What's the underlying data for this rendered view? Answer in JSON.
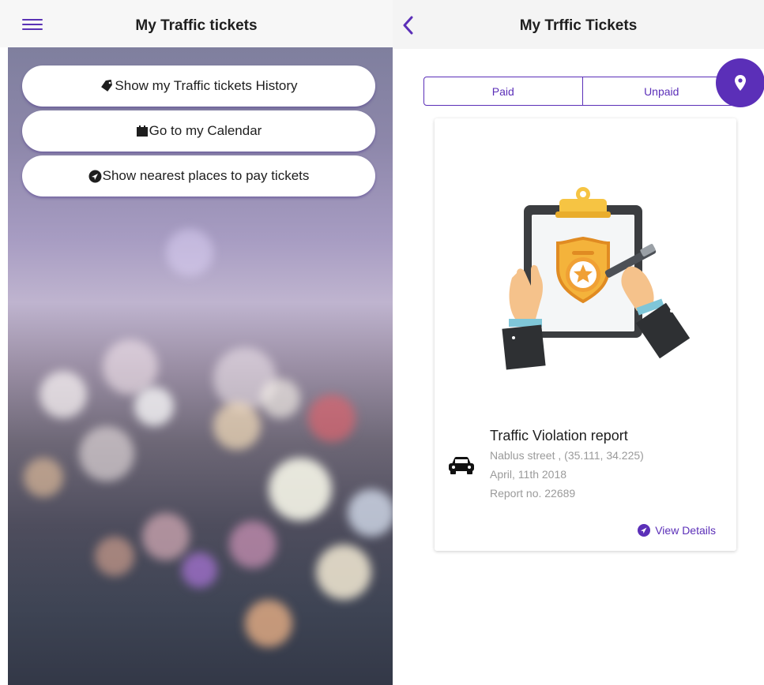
{
  "left": {
    "header": {
      "title": "My Traffic tickets",
      "menu_icon": "hamburger-menu-icon"
    },
    "buttons": [
      {
        "label": "Show my Traffic tickets History",
        "icon": "tag-icon"
      },
      {
        "label": "Go to my Calendar",
        "icon": "calendar-icon"
      },
      {
        "label": "Show nearest places to pay tickets",
        "icon": "navigation-icon"
      }
    ]
  },
  "right": {
    "header": {
      "title": "My Trffic Tickets",
      "back_icon": "chevron-left-icon"
    },
    "tabs": [
      {
        "label": "Paid"
      },
      {
        "label": "Unpaid"
      }
    ],
    "fab_icon": "map-pin-icon",
    "card": {
      "title": "Traffic Violation report",
      "location": "Nablus street , (35.111, 34.225)",
      "date": "April, 11th 2018",
      "report_no": "Report no. 22689",
      "view_details": "View Details"
    }
  },
  "colors": {
    "accent": "#5b2fb8",
    "text": "#1e1e1e",
    "muted": "#9a9a9a"
  }
}
